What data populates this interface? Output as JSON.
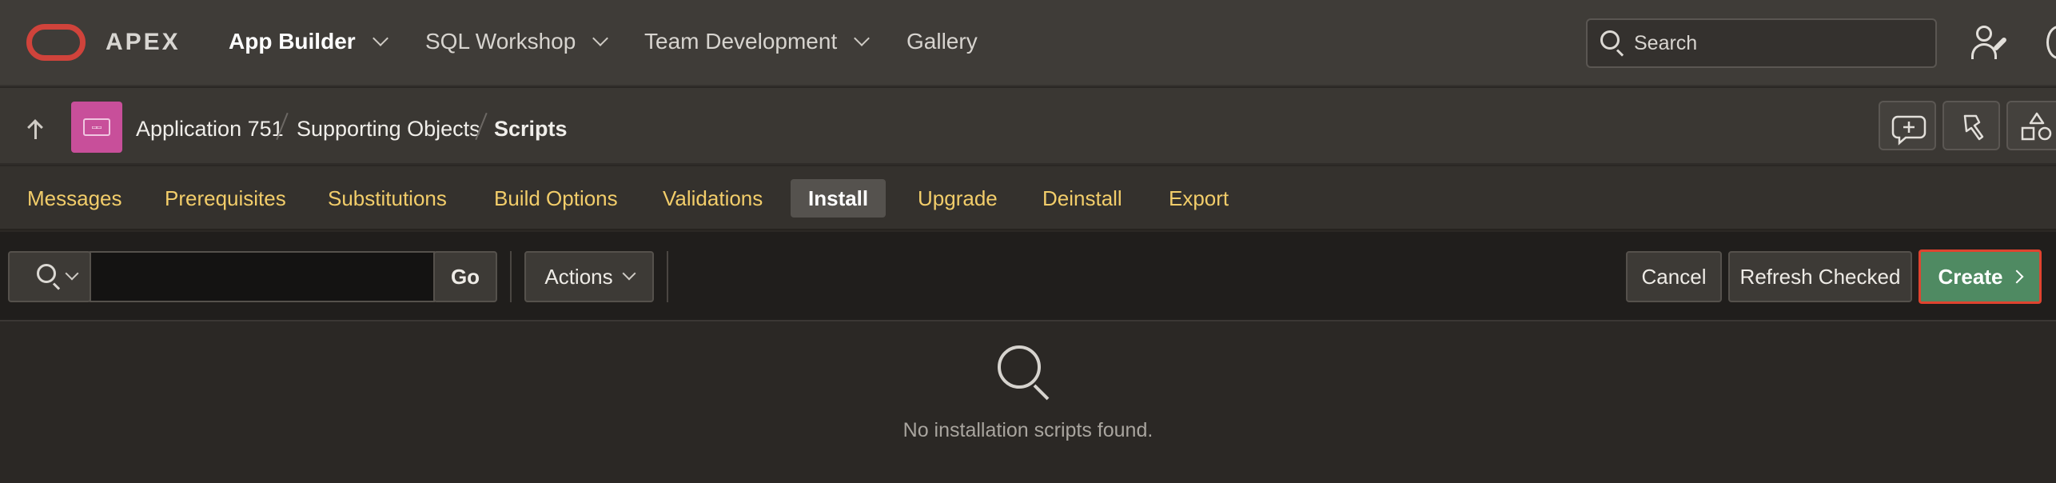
{
  "topnav": {
    "brand": "APEX",
    "items": [
      {
        "label": "App Builder",
        "dropdown": true,
        "active": true
      },
      {
        "label": "SQL Workshop",
        "dropdown": true
      },
      {
        "label": "Team Development",
        "dropdown": true
      },
      {
        "label": "Gallery",
        "dropdown": false
      }
    ],
    "search_placeholder": "Search",
    "icons": [
      "oracle-logo-icon",
      "search-icon",
      "user-admin-icon"
    ]
  },
  "breadcrumb": {
    "items": [
      "Application 751",
      "Supporting Objects",
      "Scripts"
    ],
    "icons": [
      "up-arrow-icon",
      "app-icon",
      "add-comment-icon",
      "flashlight-icon",
      "shapes-icon"
    ]
  },
  "tabs": {
    "items": [
      "Messages",
      "Prerequisites",
      "Substitutions",
      "Build Options",
      "Validations",
      "Install",
      "Upgrade",
      "Deinstall",
      "Export"
    ],
    "active": "Install"
  },
  "toolbar": {
    "go_label": "Go",
    "actions_label": "Actions",
    "cancel_label": "Cancel",
    "refresh_label": "Refresh Checked",
    "create_label": "Create",
    "search_value": ""
  },
  "empty_state": {
    "message": "No installation scripts found."
  },
  "colors": {
    "tab_text": "#f2cd6a",
    "create_bg": "#4f8a62",
    "create_border": "#e0432f",
    "logo": "#d0433b",
    "app_icon": "#c84f9a"
  }
}
